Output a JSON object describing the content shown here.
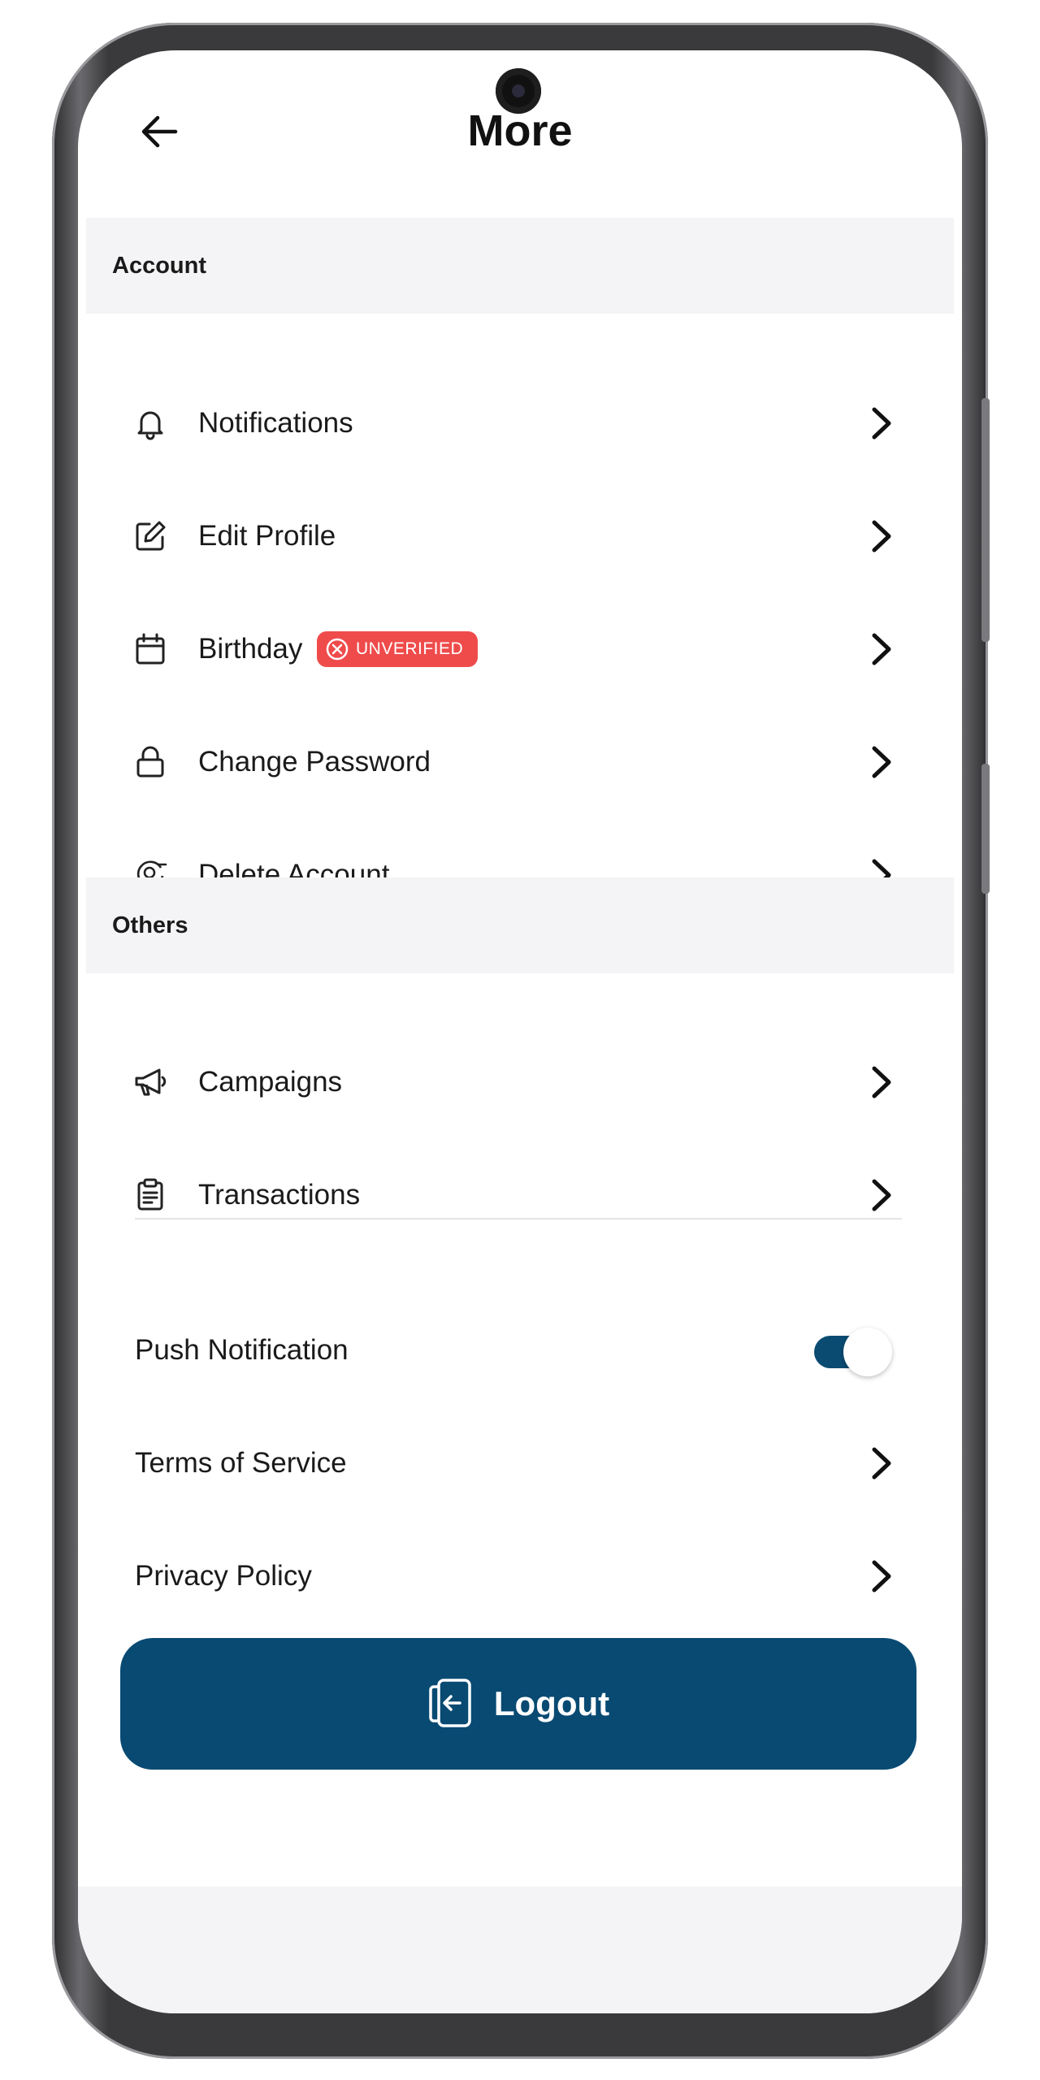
{
  "header": {
    "title": "More"
  },
  "sections": {
    "account": "Account",
    "others": "Others"
  },
  "account_items": [
    {
      "label": "Notifications",
      "icon": "bell-icon"
    },
    {
      "label": "Edit Profile",
      "icon": "edit-icon"
    },
    {
      "label": "Birthday",
      "icon": "calendar-icon",
      "badge": "UNVERIFIED"
    },
    {
      "label": "Change Password",
      "icon": "lock-icon"
    },
    {
      "label": "Delete Account",
      "icon": "user-remove-icon"
    }
  ],
  "other_items": [
    {
      "label": "Campaigns",
      "icon": "megaphone-icon"
    },
    {
      "label": "Transactions",
      "icon": "clipboard-icon"
    }
  ],
  "settings": {
    "push_notification": {
      "label": "Push Notification",
      "enabled": true
    },
    "terms": "Terms of Service",
    "privacy": "Privacy Policy"
  },
  "logout": {
    "label": "Logout",
    "icon": "logout-icon"
  },
  "colors": {
    "primary": "#084a72",
    "badge": "#ef4b4b",
    "section_bg": "#f4f4f6"
  }
}
